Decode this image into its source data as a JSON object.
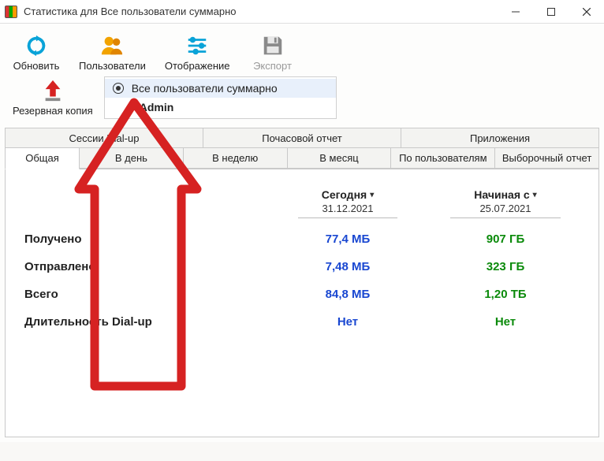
{
  "window": {
    "title": "Статистика для Все пользователи суммарно"
  },
  "toolbar": {
    "refresh": "Обновить",
    "users": "Пользователи",
    "display": "Отображение",
    "export": "Экспорт",
    "backup": "Резервная копия"
  },
  "dropdown": {
    "all_users": "Все пользователи суммарно",
    "admin": "Admin"
  },
  "tabs_top": {
    "dialup": "Сессии Dial-up",
    "hourly": "Почасовой отчет",
    "apps": "Приложения"
  },
  "tabs_bottom": {
    "general": "Общая",
    "daily": "В день",
    "weekly": "В неделю",
    "monthly": "В месяц",
    "byuser": "По пользователям",
    "custom": "Выборочный отчет"
  },
  "stats": {
    "col_today_label": "Сегодня",
    "col_today_date": "31.12.2021",
    "col_since_label": "Начиная с",
    "col_since_date": "25.07.2021",
    "rows": {
      "received": {
        "label": "Получено",
        "today": "77,4 МБ",
        "since": "907 ГБ"
      },
      "sent": {
        "label": "Отправлено",
        "today": "7,48 МБ",
        "since": "323 ГБ"
      },
      "total": {
        "label": "Всего",
        "today": "84,8 МБ",
        "since": "1,20 ТБ"
      },
      "dialup": {
        "label": "Длительность Dial-up",
        "today": "Нет",
        "since": "Нет"
      }
    }
  }
}
